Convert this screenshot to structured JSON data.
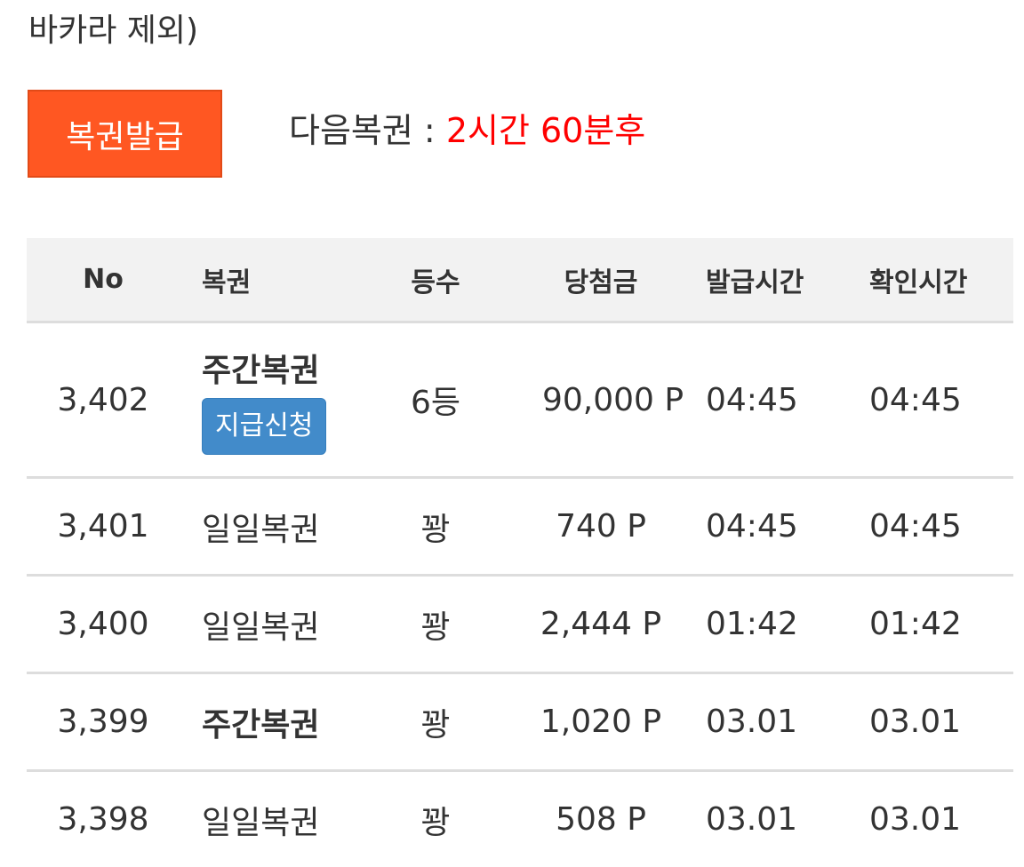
{
  "top_text": "바카라 제외)",
  "issue_button_label": "복권발급",
  "next_ticket": {
    "label": "다음복권 : ",
    "countdown": "2시간 60분후"
  },
  "table": {
    "headers": [
      "No",
      "복권",
      "등수",
      "당첨금",
      "발급시간",
      "확인시간"
    ],
    "rows": [
      {
        "no": "3,402",
        "ticket": "주간복권",
        "bold": true,
        "claim": "지급신청",
        "rank": "6등",
        "prize": "90,000 P",
        "issued": "04:45",
        "checked": "04:45"
      },
      {
        "no": "3,401",
        "ticket": "일일복권",
        "bold": false,
        "rank": "꽝",
        "prize": "740 P",
        "issued": "04:45",
        "checked": "04:45"
      },
      {
        "no": "3,400",
        "ticket": "일일복권",
        "bold": false,
        "rank": "꽝",
        "prize": "2,444 P",
        "issued": "01:42",
        "checked": "01:42"
      },
      {
        "no": "3,399",
        "ticket": "주간복권",
        "bold": true,
        "rank": "꽝",
        "prize": "1,020 P",
        "issued": "03.01",
        "checked": "03.01"
      },
      {
        "no": "3,398",
        "ticket": "일일복권",
        "bold": false,
        "rank": "꽝",
        "prize": "508 P",
        "issued": "03.01",
        "checked": "03.01"
      }
    ]
  }
}
